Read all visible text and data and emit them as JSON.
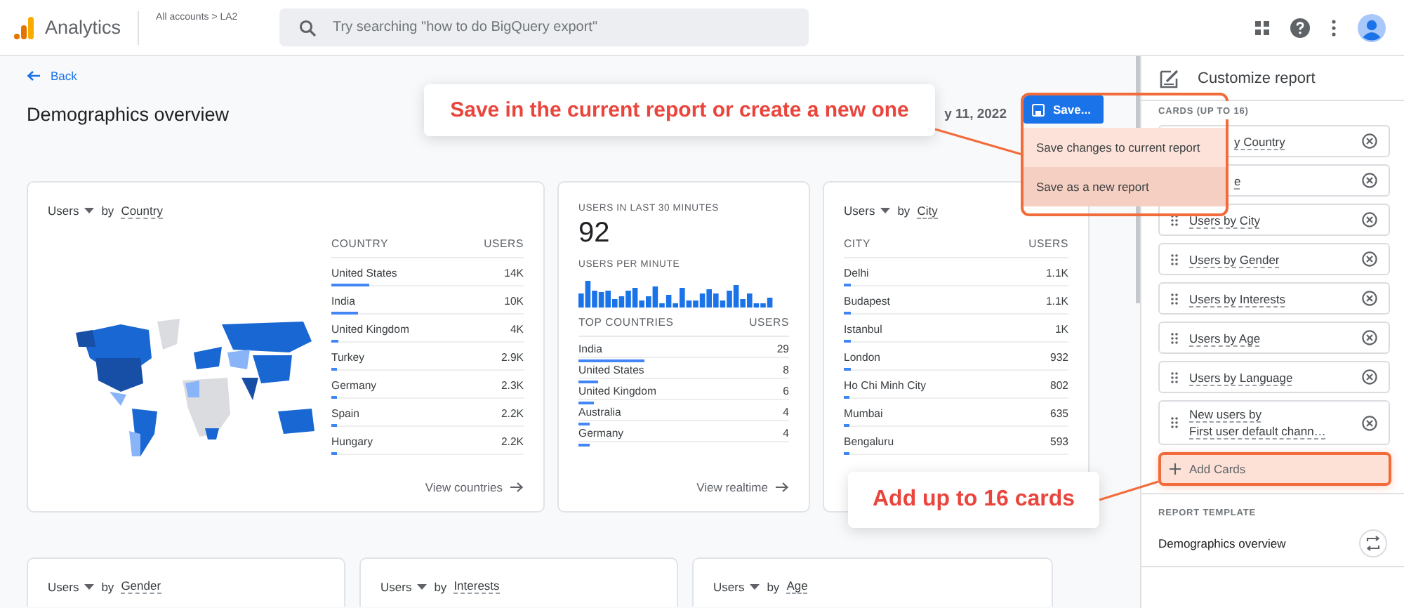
{
  "app": {
    "name": "Analytics",
    "breadcrumb": "All accounts > LA2"
  },
  "search": {
    "placeholder": "Try searching \"how to do BigQuery export\""
  },
  "header": {
    "back": "Back",
    "title": "Demographics overview",
    "date": "y 11, 2022",
    "save_button": "Save...",
    "save_menu": [
      {
        "label": "Save changes to current report",
        "selected": false
      },
      {
        "label": "Save as a new report",
        "selected": true
      }
    ]
  },
  "card_rows": [
    [
      {
        "kind": "map_table",
        "metric": "Users",
        "connector": "by",
        "dimension": "Country",
        "columns": [
          "COUNTRY",
          "USERS"
        ],
        "rows": [
          {
            "label": "United States",
            "value": "14K",
            "level": 0.2
          },
          {
            "label": "India",
            "value": "10K",
            "level": 0.14
          },
          {
            "label": "United Kingdom",
            "value": "4K",
            "level": 0.04
          },
          {
            "label": "Turkey",
            "value": "2.9K",
            "level": 0.03
          },
          {
            "label": "Germany",
            "value": "2.3K",
            "level": 0.03
          },
          {
            "label": "Spain",
            "value": "2.2K",
            "level": 0.03
          },
          {
            "label": "Hungary",
            "value": "2.2K",
            "level": 0.03
          }
        ],
        "link": "View countries"
      },
      {
        "kind": "realtime",
        "title": "USERS IN LAST 30 MINUTES",
        "value": "92",
        "subtitle": "USERS PER MINUTE",
        "columns": [
          "TOP COUNTRIES",
          "USERS"
        ],
        "rows": [
          {
            "label": "India",
            "value": "29",
            "level": 0.31
          },
          {
            "label": "United States",
            "value": "8",
            "level": 0.09
          },
          {
            "label": "United Kingdom",
            "value": "6",
            "level": 0.07
          },
          {
            "label": "Australia",
            "value": "4",
            "level": 0.05
          },
          {
            "label": "Germany",
            "value": "4",
            "level": 0.05
          }
        ],
        "link": "View realtime"
      },
      {
        "kind": "table",
        "metric": "Users",
        "connector": "by",
        "dimension": "City",
        "columns": [
          "CITY",
          "USERS"
        ],
        "rows": [
          {
            "label": "Delhi",
            "value": "1.1K",
            "level": 0.03
          },
          {
            "label": "Budapest",
            "value": "1.1K",
            "level": 0.03
          },
          {
            "label": "Istanbul",
            "value": "1K",
            "level": 0.03
          },
          {
            "label": "London",
            "value": "932",
            "level": 0.03
          },
          {
            "label": "Ho Chi Minh City",
            "value": "802",
            "level": 0.02
          },
          {
            "label": "Mumbai",
            "value": "635",
            "level": 0.02
          },
          {
            "label": "Bengaluru",
            "value": "593",
            "level": 0.02
          }
        ]
      }
    ],
    [
      {
        "kind": "table",
        "metric": "Users",
        "connector": "by",
        "dimension": "Gender"
      },
      {
        "kind": "table",
        "metric": "Users",
        "connector": "by",
        "dimension": "Interests"
      },
      {
        "kind": "table",
        "metric": "Users",
        "connector": "by",
        "dimension": "Age"
      }
    ]
  ],
  "customize_panel": {
    "title": "Customize report",
    "section": "CARDS (UP TO 16)",
    "cards": [
      {
        "label": "y Country",
        "covered": true
      },
      {
        "label": "e",
        "covered": true
      },
      {
        "label": "Users by City",
        "covered": false
      },
      {
        "label": "Users by Gender",
        "covered": false
      },
      {
        "label": "Users by Interests",
        "covered": false
      },
      {
        "label": "Users by Age",
        "covered": false
      },
      {
        "label": "Users by Language",
        "covered": false
      },
      {
        "label": "New users by\nFirst user default chann…",
        "covered": false
      }
    ],
    "add_button": "Add Cards",
    "template_label": "REPORT TEMPLATE",
    "template_name": "Demographics overview"
  },
  "callouts": [
    {
      "text": "Save in the current report or create a new one"
    },
    {
      "text": "Add up to 16 cards"
    }
  ]
}
